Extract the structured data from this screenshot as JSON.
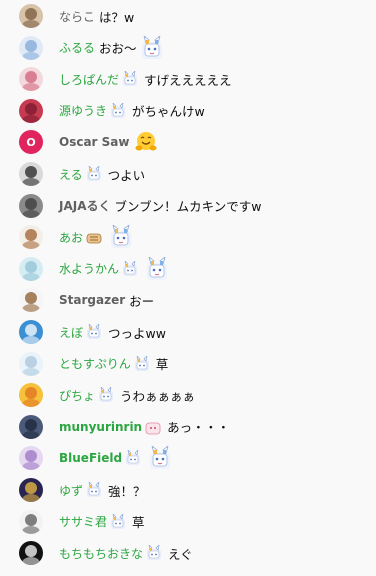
{
  "messages": [
    {
      "author": "ならこ",
      "author_style": "gray",
      "badge": false,
      "text": "は？w",
      "emoji_after": false,
      "avatar": {
        "icon": "anime-face-avatar",
        "bg": "#d8c2a8",
        "fg": "#7a5a3c"
      }
    },
    {
      "author": "ふるる",
      "author_style": "green",
      "badge": false,
      "text": "おお～",
      "emoji_after": true,
      "avatar": {
        "icon": "bunny-sketch-avatar",
        "bg": "#dfeaf6",
        "fg": "#7fa8d8"
      }
    },
    {
      "author": "しろぱんだ",
      "author_style": "green",
      "badge": true,
      "text": "すげえええええ",
      "emoji_after": false,
      "avatar": {
        "icon": "pink-character-avatar",
        "bg": "#f3d9de",
        "fg": "#d0607a"
      }
    },
    {
      "author": "源ゆうき",
      "author_style": "green",
      "badge": true,
      "text": "がちゃんけw",
      "emoji_after": false,
      "avatar": {
        "icon": "red-hair-avatar",
        "bg": "#c73b52",
        "fg": "#7a1a2c"
      }
    },
    {
      "author": "Oscar Saw",
      "author_style": "mixed-bold",
      "badge": false,
      "text": "",
      "emoji_after": true,
      "emoji_kind": "hug-emoji",
      "avatar": {
        "icon": "letter-avatar",
        "letter": "O",
        "bg": "#e0245e",
        "fg": "#ffffff"
      }
    },
    {
      "author": "える",
      "author_style": "green",
      "badge": true,
      "text": "つよい",
      "emoji_after": false,
      "avatar": {
        "icon": "gothic-l-avatar",
        "bg": "#d9d9d9",
        "fg": "#222222"
      }
    },
    {
      "author": "JAJAるく",
      "author_style": "mixed-bold",
      "badge": false,
      "text": "ブンブン！ムカキンですw",
      "emoji_after": false,
      "avatar": {
        "icon": "photo-avatar",
        "bg": "#8a8a8a",
        "fg": "#3a3a3a"
      }
    },
    {
      "author": "あお",
      "author_style": "green",
      "badge": true,
      "badge_kind": "bread",
      "text": "",
      "emoji_after": true,
      "avatar": {
        "icon": "goggles-avatar",
        "bg": "#f4efe6",
        "fg": "#a06030"
      }
    },
    {
      "author": "水ようかん",
      "author_style": "green",
      "badge": true,
      "text": "",
      "emoji_after": true,
      "avatar": {
        "icon": "pale-blue-rabbit-avatar",
        "bg": "#d6ecf3",
        "fg": "#8fc3d6"
      }
    },
    {
      "author": "Stargazer",
      "author_style": "mixed-bold",
      "badge": false,
      "text": "おー",
      "emoji_after": false,
      "avatar": {
        "icon": "dog-avatar",
        "bg": "#f5f5f5",
        "fg": "#8a5a2a"
      }
    },
    {
      "author": "えぼ",
      "author_style": "green",
      "badge": true,
      "text": "つっよww",
      "emoji_after": false,
      "avatar": {
        "icon": "blue-drop-avatar",
        "bg": "#3d8fd4",
        "fg": "#ffffff"
      }
    },
    {
      "author": "ともすぷりん",
      "author_style": "green",
      "badge": true,
      "text": "草",
      "emoji_after": false,
      "avatar": {
        "icon": "white-hair-avatar",
        "bg": "#e9f3f9",
        "fg": "#a9c6dc"
      }
    },
    {
      "author": "ぴちょ",
      "author_style": "green",
      "badge": true,
      "text": "うわぁぁぁぁ",
      "emoji_after": false,
      "avatar": {
        "icon": "sunset-avatar",
        "bg": "#f6c13b",
        "fg": "#e07020"
      }
    },
    {
      "author": "munyurinrin",
      "author_style": "green bold",
      "badge": true,
      "badge_kind": "pink",
      "text": "あっ・・・",
      "emoji_after": false,
      "avatar": {
        "icon": "dark-hair-avatar",
        "bg": "#4a5a78",
        "fg": "#1e2638"
      }
    },
    {
      "author": "BlueField",
      "author_style": "green bold",
      "badge": true,
      "text": "",
      "emoji_after": true,
      "avatar": {
        "icon": "purple-character-avatar",
        "bg": "#e5d8f0",
        "fg": "#9a74c4"
      }
    },
    {
      "author": "ゆず",
      "author_style": "green",
      "badge": true,
      "text": "強！？",
      "emoji_after": false,
      "avatar": {
        "icon": "purple-night-avatar",
        "bg": "#2a2450",
        "fg": "#f0c040"
      }
    },
    {
      "author": "ササミ君",
      "author_style": "green",
      "badge": true,
      "text": "草",
      "emoji_after": false,
      "avatar": {
        "icon": "white-rabbit-avatar",
        "bg": "#f2f2f2",
        "fg": "#555555"
      }
    },
    {
      "author": "もちもちおきな",
      "author_style": "green",
      "badge": true,
      "text": "えぐ",
      "emoji_after": false,
      "avatar": {
        "icon": "k-logo-avatar",
        "bg": "#111111",
        "fg": "#ffffff"
      }
    }
  ]
}
